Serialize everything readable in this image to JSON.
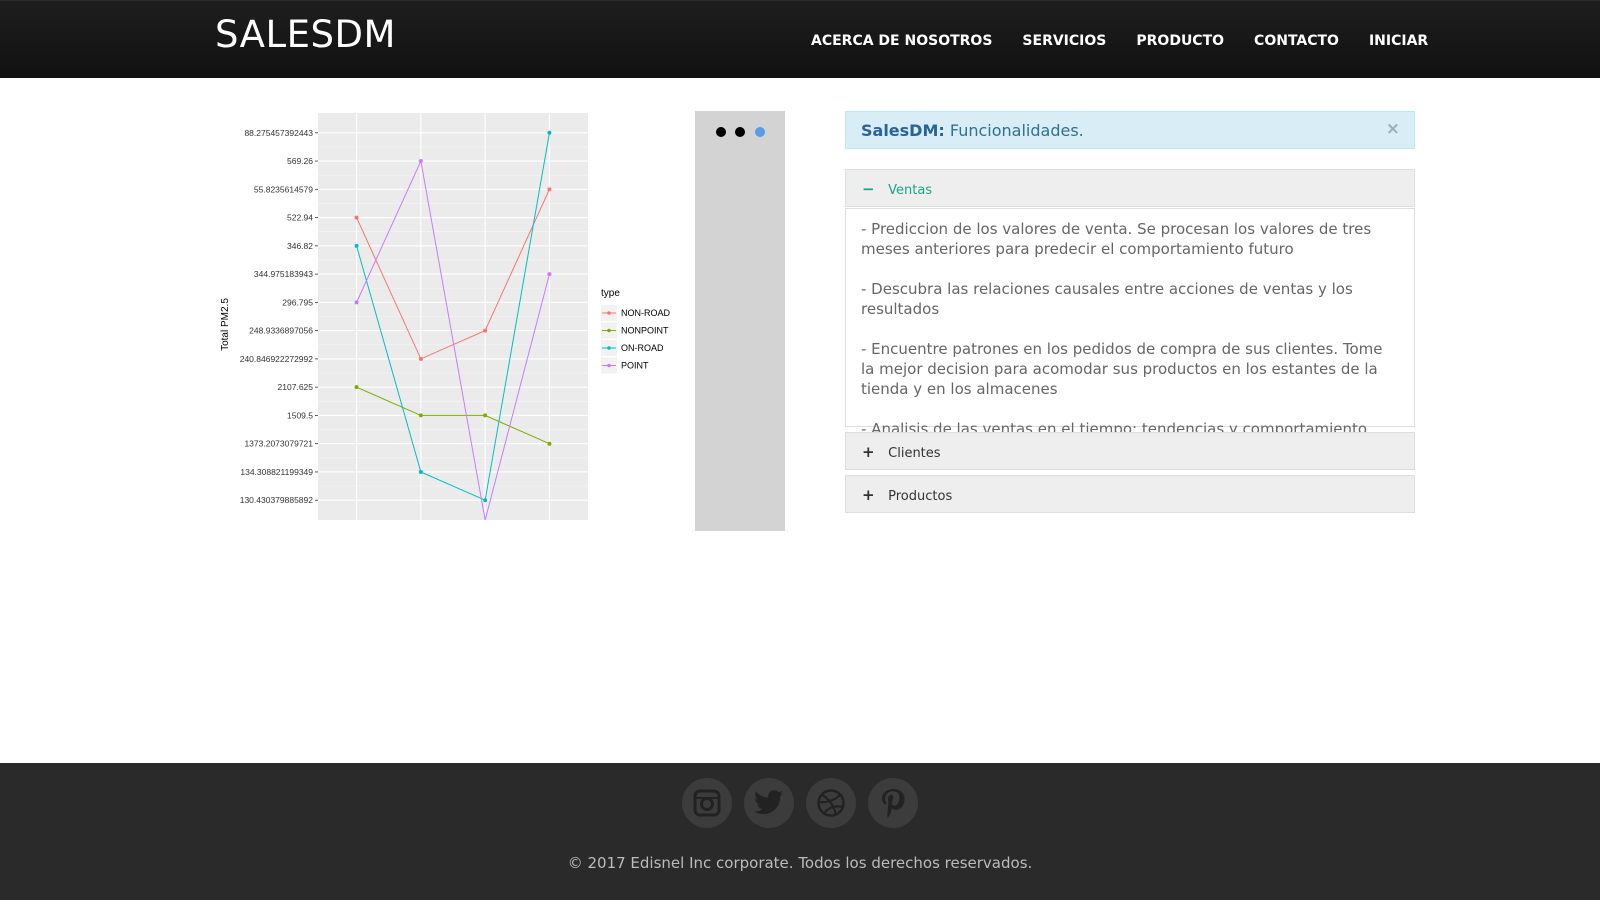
{
  "navbar": {
    "brand": "SALESDM",
    "items": [
      "ACERCA DE NOSOTROS",
      "SERVICIOS",
      "PRODUCTO",
      "CONTACTO",
      "INICIAR"
    ]
  },
  "chart_data": {
    "type": "line",
    "ylabel": "Total PM2.5",
    "y_tick_labels": [
      "88.275457392443",
      "569.26",
      "55.8235614579",
      "522.94",
      "346.82",
      "344.975183943",
      "296.795",
      "248.9336897056",
      "240.846922272992",
      "2107.625",
      "1509.5",
      "1373.2073079721",
      "134.308821199349",
      "130.430379885892"
    ],
    "x": [
      1,
      2,
      3,
      4
    ],
    "ylim": [
      0.3,
      14.7
    ],
    "legend_title": "type",
    "legend_position": "right",
    "grid": true,
    "series": [
      {
        "name": "NON-ROAD",
        "color": "#f8766d",
        "values": [
          11,
          6,
          7,
          12
        ]
      },
      {
        "name": "NONPOINT",
        "color": "#7cae00",
        "values": [
          5,
          4,
          4,
          3
        ]
      },
      {
        "name": "ON-ROAD",
        "color": "#00bfc4",
        "values": [
          10,
          2,
          1,
          14
        ]
      },
      {
        "name": "POINT",
        "color": "#c77cff",
        "values": [
          8,
          13,
          0.3,
          9
        ]
      }
    ]
  },
  "carousel": {
    "dot_colors": [
      "#000000",
      "#000000",
      "#5a9be8"
    ]
  },
  "alert": {
    "title": "SalesDM:",
    "text": "Funcionalidades.",
    "close": "×"
  },
  "accordion": {
    "panels": [
      {
        "sign": "−",
        "title": "Ventas",
        "expanded": true,
        "color": "#1aa58a"
      },
      {
        "sign": "+",
        "title": "Clientes",
        "expanded": false,
        "color": "#333333"
      },
      {
        "sign": "+",
        "title": "Productos",
        "expanded": false,
        "color": "#333333"
      }
    ],
    "ventas_items": [
      "- Prediccion de los valores de venta. Se procesan los valores de tres meses anteriores para predecir el comportamiento futuro",
      "- Descubra las relaciones causales entre acciones de ventas y los resultados",
      "- Encuentre patrones en los pedidos de compra de sus clientes. Tome la mejor decision para acomodar sus productos en los estantes de la tienda y en los almacenes",
      "- Analisis de las ventas en el tiempo: tendencias y comportamiento"
    ]
  },
  "footer": {
    "social": [
      "instagram-icon",
      "twitter-icon",
      "dribbble-icon",
      "pinterest-icon"
    ],
    "copyright": "© 2017 Edisnel Inc corporate. Todos los derechos reservados."
  }
}
